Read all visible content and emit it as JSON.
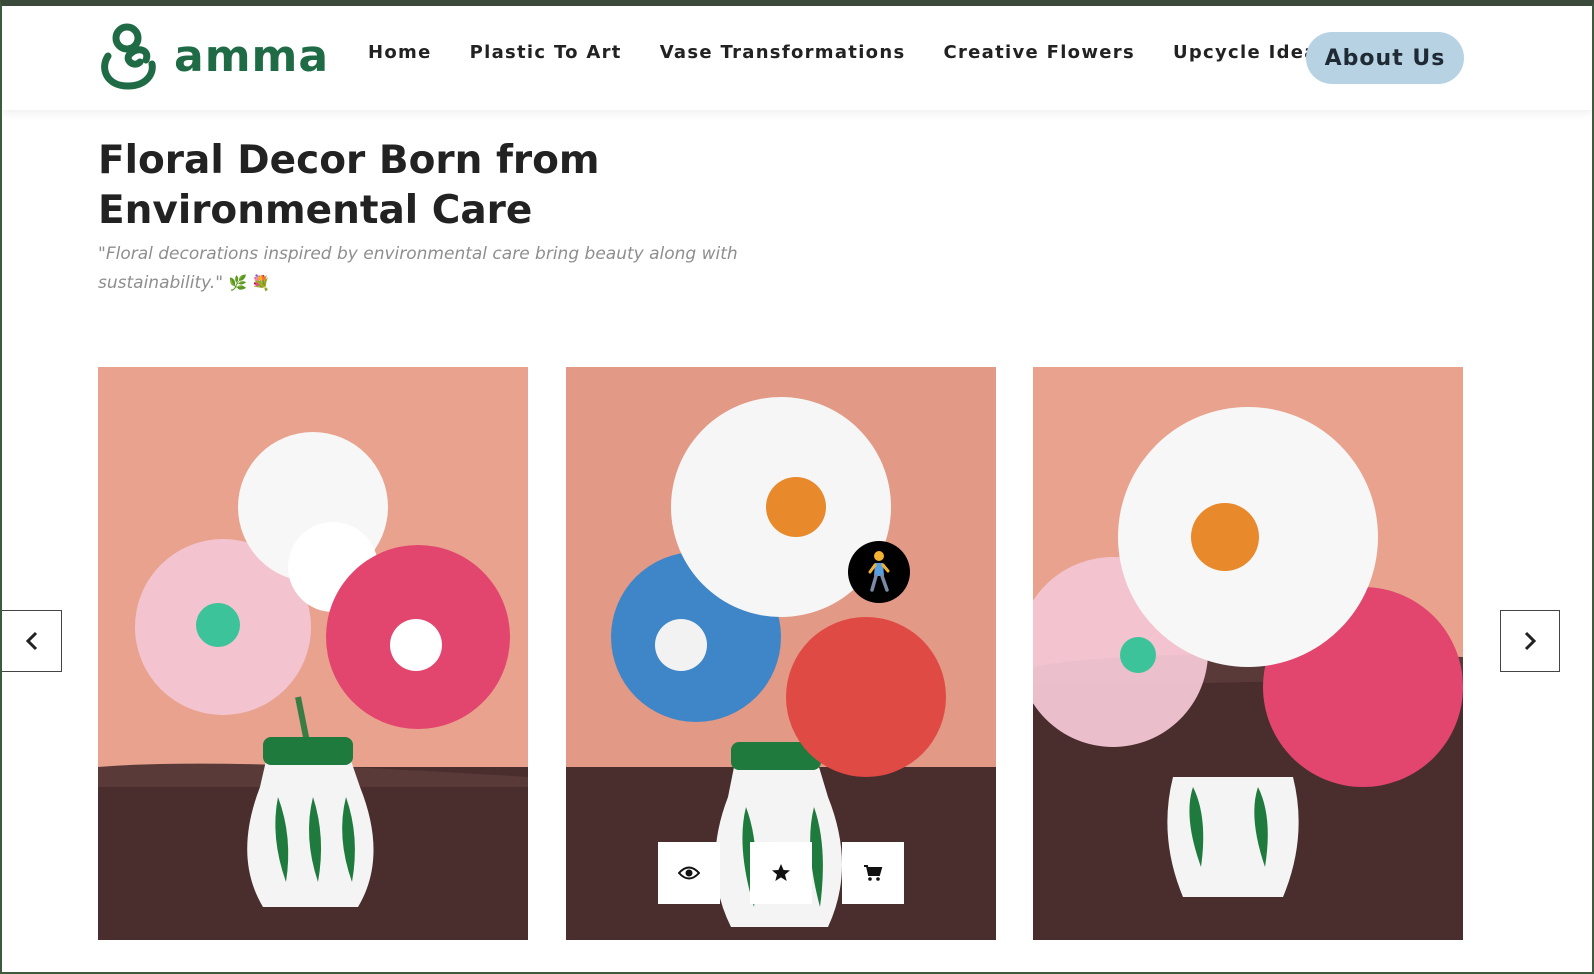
{
  "brand": {
    "name": "amma",
    "color": "#1e6b45"
  },
  "nav": {
    "items": [
      "Home",
      "Plastic To Art",
      "Vase Transformations",
      "Creative Flowers",
      "Upcycle Ideas"
    ],
    "cta": "About Us"
  },
  "hero": {
    "title_line1": "Floral Decor Born from",
    "title_line2": "Environmental Care",
    "quote": "\"Floral decorations inspired by environmental care bring beauty along with sustainability.\"",
    "emoji": "🌿 💐"
  },
  "gallery": {
    "images": [
      "plastic-flower-vase-photo",
      "plastic-flower-vase-photo",
      "plastic-flower-vase-photo"
    ],
    "actions": [
      "eye-icon",
      "star-icon",
      "cart-icon"
    ]
  },
  "colors": {
    "about_bg": "#b7d3e3",
    "accent": "#1e6b45"
  }
}
